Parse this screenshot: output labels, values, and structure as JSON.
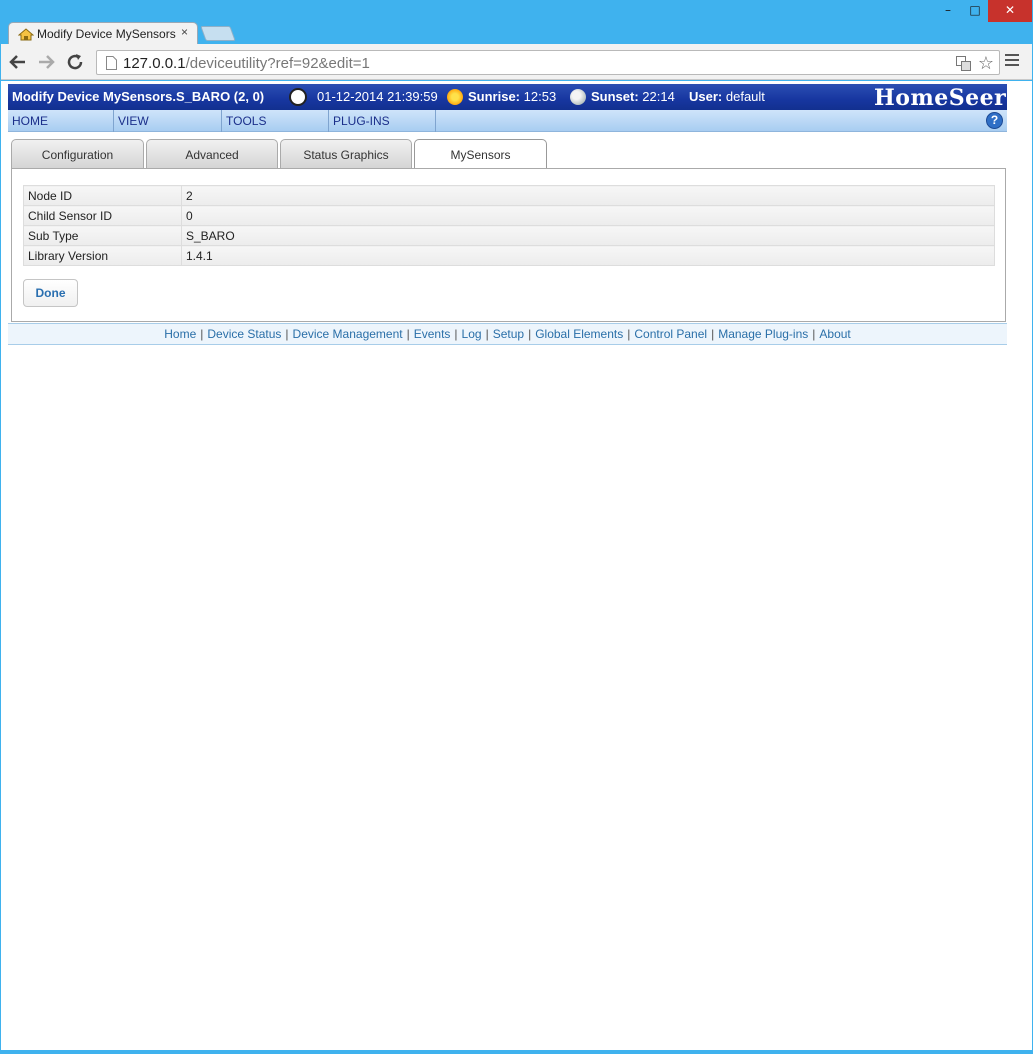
{
  "window": {
    "minimize_glyph": "–",
    "maximize_glyph": "□",
    "close_glyph": "✕"
  },
  "browser": {
    "tab_title": "Modify Device MySensors",
    "tab_close_glyph": "×",
    "url_host": "127.0.0.1",
    "url_path": "/deviceutility?ref=92&edit=1",
    "icons": [
      "back-arrow-icon",
      "forward-arrow-icon",
      "reload-icon",
      "page-icon",
      "translate-icon",
      "star-icon",
      "menu-icon"
    ]
  },
  "header": {
    "title": "Modify Device MySensors.S_BARO (2, 0)",
    "datetime": "01-12-2014 21:39:59",
    "sunrise_label": "Sunrise:",
    "sunrise_time": "12:53",
    "sunset_label": "Sunset:",
    "sunset_time": "22:14",
    "user_label": "User:",
    "user_name": "default",
    "logo": "HomeSeer"
  },
  "menu": {
    "items": [
      "HOME",
      "VIEW",
      "TOOLS",
      "PLUG-INS"
    ],
    "help": "?"
  },
  "tabs": {
    "items": [
      "Configuration",
      "Advanced",
      "Status Graphics",
      "MySensors"
    ],
    "active": "MySensors"
  },
  "details": {
    "rows": [
      {
        "label": "Node ID",
        "value": "2"
      },
      {
        "label": "Child Sensor ID",
        "value": "0"
      },
      {
        "label": "Sub Type",
        "value": "S_BARO"
      },
      {
        "label": "Library Version",
        "value": "1.4.1"
      }
    ],
    "done_label": "Done"
  },
  "footer": {
    "links": [
      "Home",
      "Device Status",
      "Device Management",
      "Events",
      "Log",
      "Setup",
      "Global Elements",
      "Control Panel",
      "Manage Plug-ins",
      "About"
    ],
    "separator": "|"
  },
  "colors": {
    "header_bg": "#1736a0",
    "menu_bg": "#a8cdf1",
    "link": "#2a6fa8",
    "window_frame": "#3fb2ee",
    "close_button": "#c7322c"
  }
}
